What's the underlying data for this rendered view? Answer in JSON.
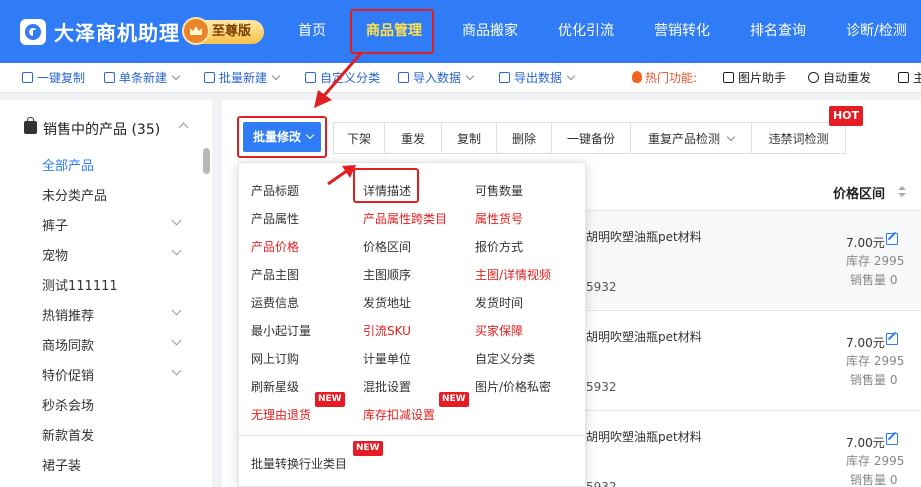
{
  "header": {
    "brand": "大泽商机助理",
    "edition": "至尊版",
    "nav": [
      "首页",
      "商品管理",
      "商品搬家",
      "优化引流",
      "营销转化",
      "排名查询",
      "诊断/检测"
    ]
  },
  "toolbar": {
    "items": [
      {
        "label": "一键复制",
        "dropdown": false
      },
      {
        "label": "单条新建",
        "dropdown": true
      },
      {
        "label": "批量新建",
        "dropdown": true
      },
      {
        "label": "自定义分类",
        "dropdown": false
      },
      {
        "label": "导入数据",
        "dropdown": true
      },
      {
        "label": "导出数据",
        "dropdown": true
      }
    ],
    "hot": "热门功能:",
    "extras": [
      "图片助手",
      "自动重发",
      "主"
    ]
  },
  "sidebar": {
    "title": "销售中的产品 (35)",
    "items": [
      {
        "label": "全部产品",
        "active": true,
        "expandable": false
      },
      {
        "label": "未分类产品",
        "active": false,
        "expandable": false
      },
      {
        "label": "裤子",
        "active": false,
        "expandable": true
      },
      {
        "label": "宠物",
        "active": false,
        "expandable": true
      },
      {
        "label": "测试111111",
        "active": false,
        "expandable": false
      },
      {
        "label": "热销推荐",
        "active": false,
        "expandable": true
      },
      {
        "label": "商场同款",
        "active": false,
        "expandable": true
      },
      {
        "label": "特价促销",
        "active": false,
        "expandable": true
      },
      {
        "label": "秒杀会场",
        "active": false,
        "expandable": false
      },
      {
        "label": "新款首发",
        "active": false,
        "expandable": false
      },
      {
        "label": "裙子装",
        "active": false,
        "expandable": false
      }
    ]
  },
  "actions": {
    "batch_edit": "批量修改",
    "buttons": [
      "下架",
      "重发",
      "复制",
      "删除",
      "一键备份",
      "重复产品检测",
      "违禁词检测"
    ],
    "hot_badge": "HOT"
  },
  "dropdown": {
    "columns": [
      [
        {
          "label": "产品标题",
          "red": false
        },
        {
          "label": "产品属性",
          "red": false
        },
        {
          "label": "产品价格",
          "red": true
        },
        {
          "label": "产品主图",
          "red": false
        },
        {
          "label": "运费信息",
          "red": false
        },
        {
          "label": "最小起订量",
          "red": false
        },
        {
          "label": "网上订购",
          "red": false
        },
        {
          "label": "刷新星级",
          "red": false
        },
        {
          "label": "无理由退货",
          "red": true,
          "new": true
        }
      ],
      [
        {
          "label": "详情描述",
          "red": false
        },
        {
          "label": "产品属性跨类目",
          "red": true
        },
        {
          "label": "价格区间",
          "red": false
        },
        {
          "label": "主图顺序",
          "red": false
        },
        {
          "label": "发货地址",
          "red": false
        },
        {
          "label": "引流SKU",
          "red": true
        },
        {
          "label": "计量单位",
          "red": false
        },
        {
          "label": "混批设置",
          "red": false
        },
        {
          "label": "库存扣减设置",
          "red": true,
          "new": true
        }
      ],
      [
        {
          "label": "可售数量",
          "red": false
        },
        {
          "label": "属性货号",
          "red": true
        },
        {
          "label": "报价方式",
          "red": false
        },
        {
          "label": "主图/详情视频",
          "red": true
        },
        {
          "label": "发货时间",
          "red": false
        },
        {
          "label": "买家保障",
          "red": true
        },
        {
          "label": "自定义分类",
          "red": false
        },
        {
          "label": "图片/价格私密",
          "red": false
        }
      ]
    ],
    "footer": "批量转换行业类目",
    "new_badge": "NEW"
  },
  "table": {
    "price_header": "价格区间",
    "rows": [
      {
        "title": "胡明吹塑油瓶pet材料",
        "tail": "5932",
        "price": "7.00元",
        "stock": "库存 2995",
        "sales": "销售量 0"
      },
      {
        "title": "胡明吹塑油瓶pet材料",
        "tail": "5932",
        "price": "7.00元",
        "stock": "库存 2995",
        "sales": "销售量 0"
      },
      {
        "title": "胡明吹塑油瓶pet材料",
        "tail": "5932",
        "price": "7.00元",
        "stock": "库存 2995",
        "sales": "销售量 0"
      }
    ]
  },
  "colors": {
    "primary": "#2f7cf6",
    "highlight": "#e02020",
    "nav_active": "#ffe14d"
  }
}
